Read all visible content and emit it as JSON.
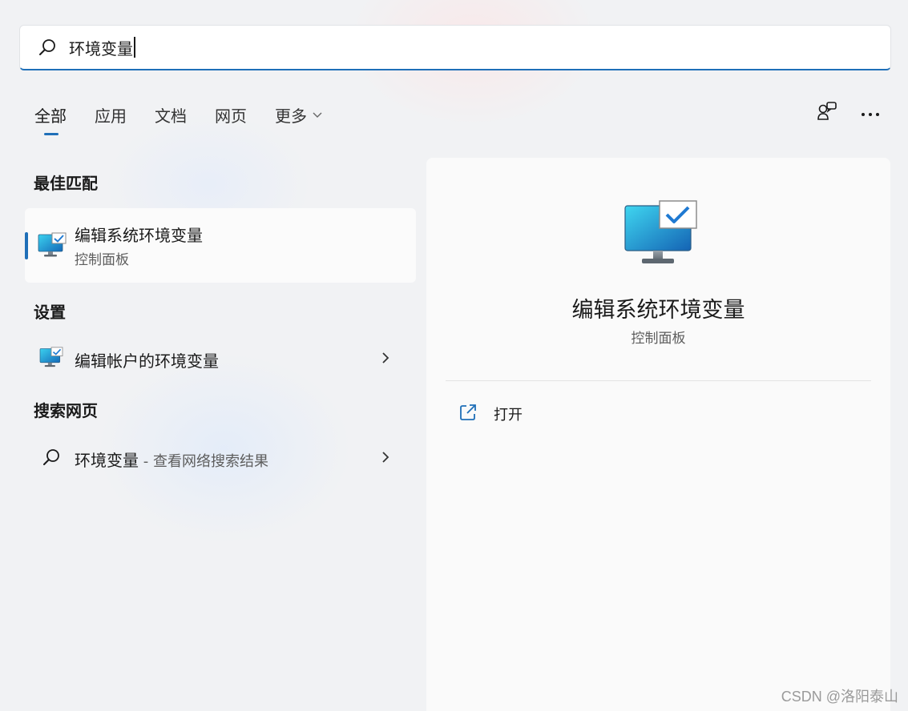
{
  "search": {
    "query": "环境变量"
  },
  "tabs": [
    {
      "label": "全部",
      "active": true
    },
    {
      "label": "应用"
    },
    {
      "label": "文档"
    },
    {
      "label": "网页"
    },
    {
      "label": "更多"
    }
  ],
  "sections": {
    "best_match": "最佳匹配",
    "settings": "设置",
    "web": "搜索网页"
  },
  "best_match": {
    "title": "编辑系统环境变量",
    "subtitle": "控制面板"
  },
  "settings_item": {
    "title": "编辑帐户的环境变量"
  },
  "web_item": {
    "term": "环境变量",
    "suffix": " - 查看网络搜索结果"
  },
  "detail": {
    "title": "编辑系统环境变量",
    "subtitle": "控制面板",
    "action_open": "打开"
  },
  "watermark": "CSDN @洛阳泰山",
  "colors": {
    "accent": "#1f6fb8",
    "monitor_screen": "#1aa3d9"
  }
}
